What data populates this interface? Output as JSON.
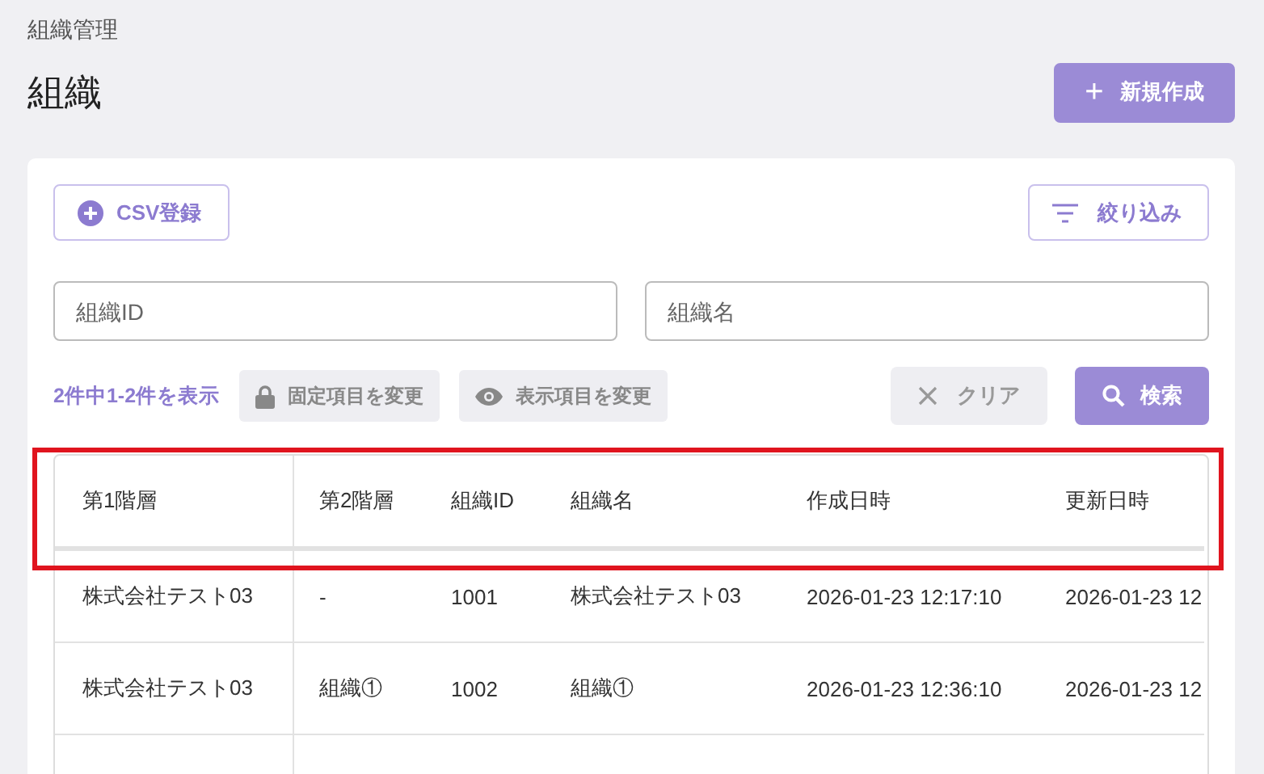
{
  "breadcrumb": "組織管理",
  "title": "組織",
  "create_button": {
    "icon": "+",
    "label": "新規作成"
  },
  "toolbar": {
    "csv_button": "CSV登録",
    "filter_button": "絞り込み"
  },
  "fields": [
    {
      "placeholder": "組織ID"
    },
    {
      "placeholder": "組織名"
    }
  ],
  "actions": {
    "count": "2件中1-2件を表示",
    "fixed_columns_button": "固定項目を変更",
    "visible_columns_button": "表示項目を変更",
    "clear_button": "クリア",
    "search_button": "検索"
  },
  "table": {
    "columns": [
      "第1階層",
      "第2階層",
      "組織ID",
      "組織名",
      "作成日時",
      "更新日時"
    ],
    "rows": [
      [
        "株式会社テスト03",
        "-",
        "1001",
        "株式会社テスト03",
        "2026-01-23 12:17:10",
        "2026-01-23 12"
      ],
      [
        "株式会社テスト03",
        "組織①",
        "1002",
        "組織①",
        "2026-01-23 12:36:10",
        "2026-01-23 12"
      ]
    ]
  }
}
